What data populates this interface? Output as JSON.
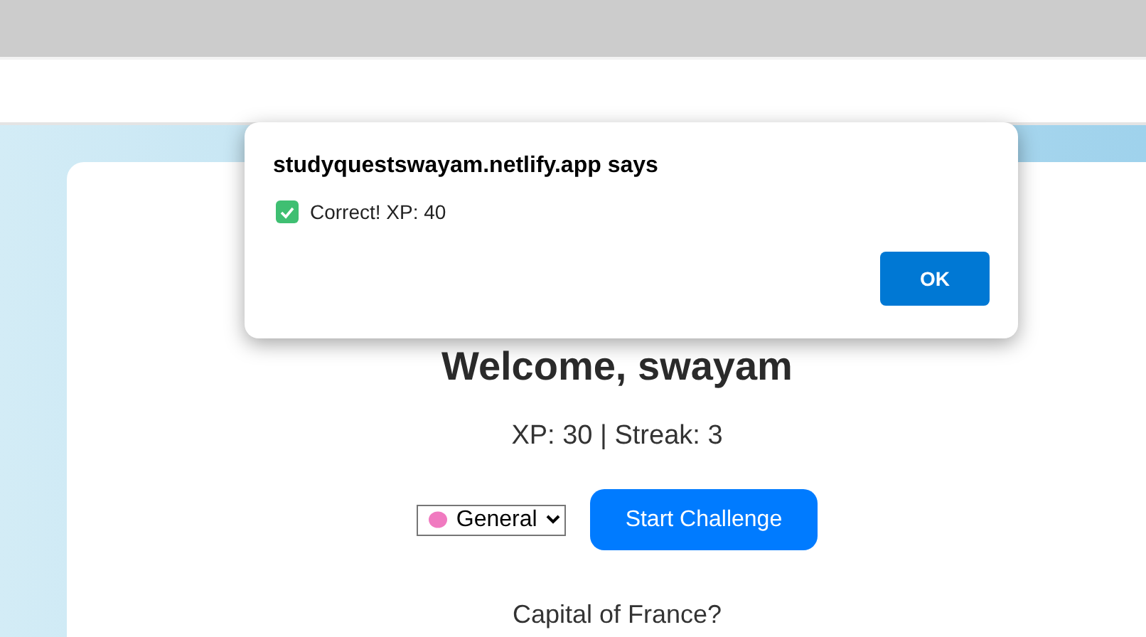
{
  "dialog": {
    "title": "studyquestswayam.netlify.app says",
    "message": "Correct! XP: 40",
    "button": "OK"
  },
  "page": {
    "heading": "Welcome, swayam",
    "stats": "XP: 30 | Streak: 3",
    "category": {
      "value": "General"
    },
    "start_button": "Start Challenge",
    "question": "Capital of France?"
  }
}
